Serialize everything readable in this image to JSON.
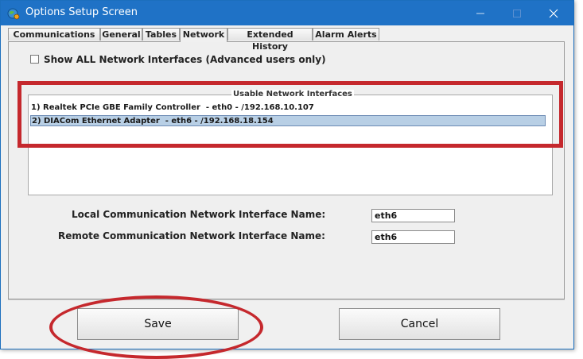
{
  "window": {
    "title": "Options Setup Screen",
    "icons": {
      "app": "globe-gear-icon",
      "minimize": "minimize-icon",
      "maximize": "maximize-icon",
      "close": "close-icon"
    },
    "colors": {
      "titlebar": "#1f72c6",
      "highlight": "#c5282d",
      "selection": "#b8cfe5"
    }
  },
  "tabs": [
    {
      "label": "Communications"
    },
    {
      "label": "General"
    },
    {
      "label": "Tables"
    },
    {
      "label": "Network",
      "active": true
    },
    {
      "label": "Extended History"
    },
    {
      "label": "Alarm Alerts"
    }
  ],
  "network": {
    "show_all_label": "Show ALL Network Interfaces (Advanced users only)",
    "show_all_checked": false,
    "interfaces_title": "Usable Network Interfaces",
    "interfaces": [
      {
        "text": "1) Realtek PCIe GBE Family Controller  - eth0 - /192.168.10.107",
        "selected": false
      },
      {
        "text": "2) DIACom Ethernet Adapter  - eth6 - /192.168.18.154",
        "selected": true
      }
    ],
    "local_label": "Local Communication Network Interface Name:",
    "local_value": "eth6",
    "remote_label": "Remote Communication Network Interface Name:",
    "remote_value": "eth6"
  },
  "buttons": {
    "save": "Save",
    "cancel": "Cancel"
  }
}
